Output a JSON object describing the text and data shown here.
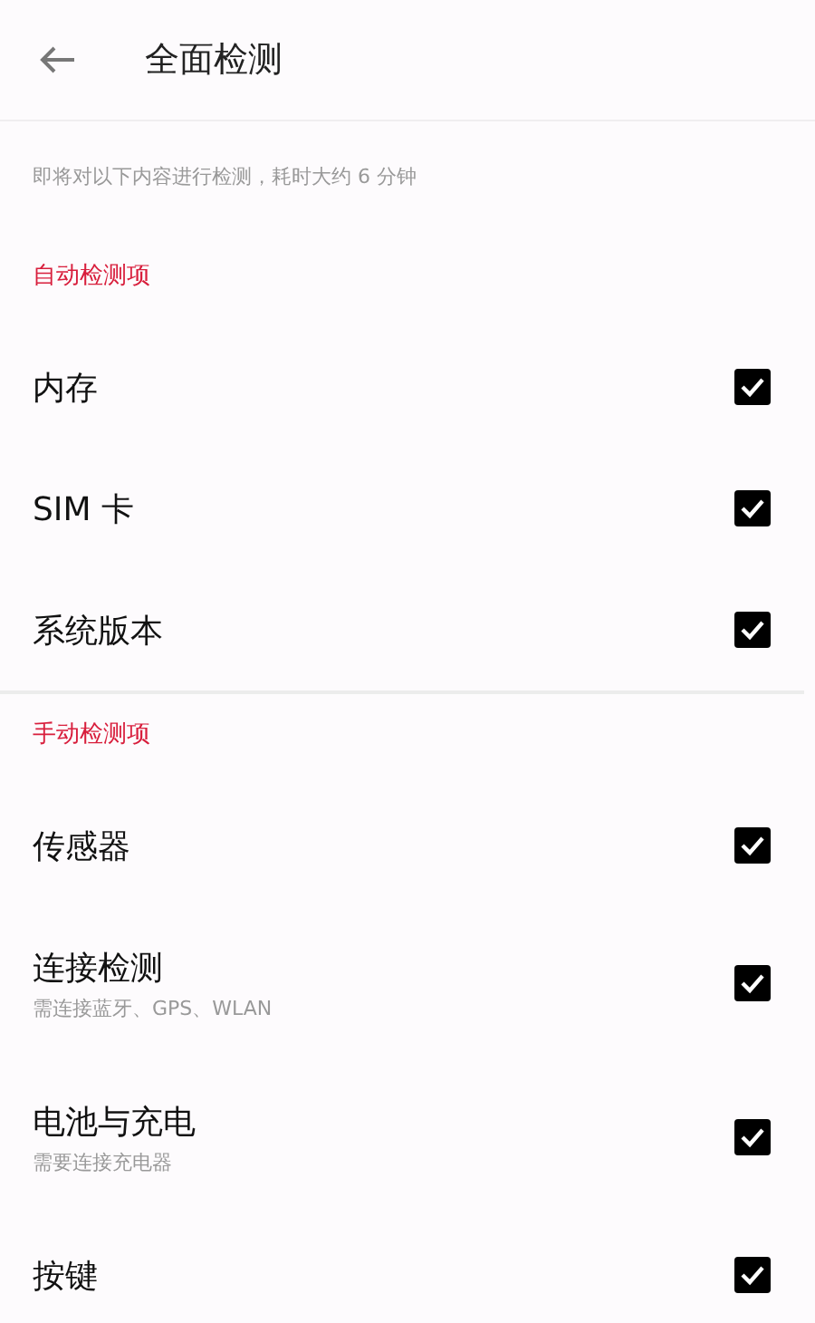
{
  "header": {
    "title": "全面检测"
  },
  "intro": "即将对以下内容进行检测，耗时大约 6 分钟",
  "sections": [
    {
      "title": "自动检测项",
      "items": [
        {
          "label": "内存",
          "checked": true
        },
        {
          "label": "SIM 卡",
          "checked": true
        },
        {
          "label": "系统版本",
          "checked": true
        }
      ]
    },
    {
      "title": "手动检测项",
      "items": [
        {
          "label": "传感器",
          "checked": true
        },
        {
          "label": "连接检测",
          "hint": "需连接蓝牙、GPS、WLAN",
          "checked": true
        },
        {
          "label": "电池与充电",
          "hint": "需要连接充电器",
          "checked": true
        },
        {
          "label": "按键",
          "checked": true
        }
      ]
    }
  ]
}
